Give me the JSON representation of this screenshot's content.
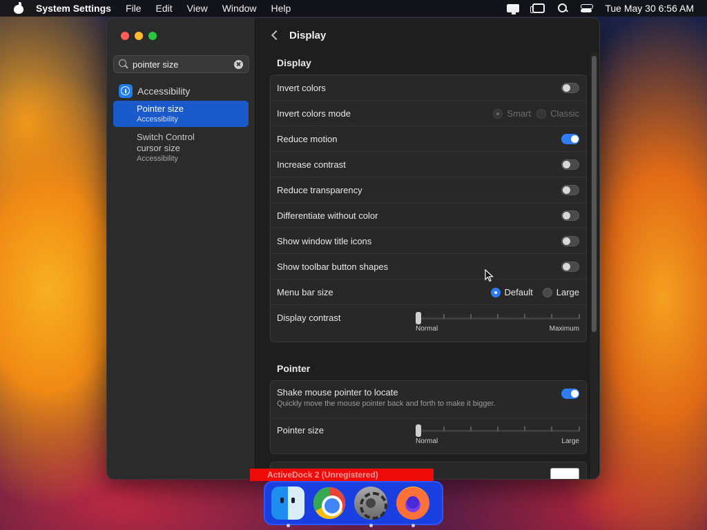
{
  "menubar": {
    "app": "System Settings",
    "items": [
      "File",
      "Edit",
      "View",
      "Window",
      "Help"
    ],
    "clock": "Tue May 30  6:56 AM"
  },
  "sidebar": {
    "search": {
      "value": "pointer size",
      "placeholder": "Search"
    },
    "category": "Accessibility",
    "results": [
      {
        "title": "Pointer size",
        "subtitle": "Accessibility",
        "selected": true
      },
      {
        "title": "Switch Control cursor size",
        "subtitle": "Accessibility",
        "selected": false
      }
    ]
  },
  "main": {
    "title": "Display",
    "display_section": {
      "title": "Display",
      "rows": {
        "invert_colors": {
          "label": "Invert colors",
          "on": false
        },
        "invert_mode": {
          "label": "Invert colors mode",
          "options": [
            "Smart",
            "Classic"
          ]
        },
        "reduce_motion": {
          "label": "Reduce motion",
          "on": true
        },
        "increase_contrast": {
          "label": "Increase contrast",
          "on": false
        },
        "reduce_transparency": {
          "label": "Reduce transparency",
          "on": false
        },
        "differentiate": {
          "label": "Differentiate without color",
          "on": false
        },
        "window_title_icons": {
          "label": "Show window title icons",
          "on": false
        },
        "toolbar_shapes": {
          "label": "Show toolbar button shapes",
          "on": false
        },
        "menu_bar_size": {
          "label": "Menu bar size",
          "options": [
            "Default",
            "Large"
          ],
          "selected": "Default"
        },
        "display_contrast": {
          "label": "Display contrast",
          "min_label": "Normal",
          "max_label": "Maximum",
          "value": 0
        }
      }
    },
    "pointer_section": {
      "title": "Pointer",
      "rows": {
        "shake": {
          "label": "Shake mouse pointer to locate",
          "description": "Quickly move the mouse pointer back and forth to make it bigger.",
          "on": true
        },
        "pointer_size": {
          "label": "Pointer size",
          "min_label": "Normal",
          "max_label": "Large",
          "value": 0
        }
      }
    }
  },
  "dock": {
    "banner": "ActiveDock 2 (Unregistered)",
    "apps": [
      "finder-icon",
      "chrome-icon",
      "system-settings-icon",
      "firefox-icon"
    ]
  },
  "colors": {
    "accent": "#2f7df6",
    "selection": "#1959c9",
    "dock": "#1a3fe0",
    "banner": "#f00b0b"
  }
}
